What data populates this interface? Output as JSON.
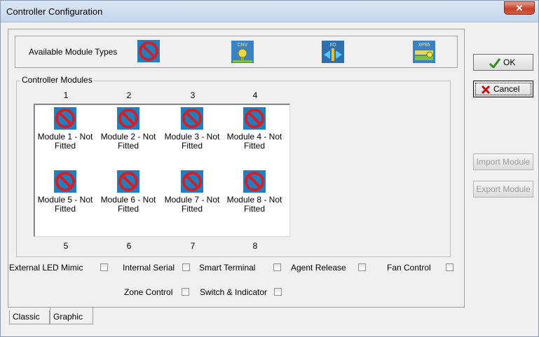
{
  "window": {
    "title": "Controller Configuration",
    "close_glyph": "✕"
  },
  "module_types": {
    "label": "Available Module Types",
    "types": [
      {
        "icon": "not-fitted-icon",
        "caption": ""
      },
      {
        "icon": "cnv-module-icon",
        "caption": "CNV"
      },
      {
        "icon": "io-module-icon",
        "caption": "I/O"
      },
      {
        "icon": "xp95-module-icon",
        "caption": "XP95"
      }
    ]
  },
  "controller_modules": {
    "label": "Controller Modules",
    "top_numbers": [
      "1",
      "2",
      "3",
      "4"
    ],
    "bottom_numbers": [
      "5",
      "6",
      "7",
      "8"
    ],
    "modules": [
      {
        "line1": "Module 1 - Not",
        "line2": "Fitted"
      },
      {
        "line1": "Module 2 - Not",
        "line2": "Fitted"
      },
      {
        "line1": "Module 3 - Not",
        "line2": "Fitted"
      },
      {
        "line1": "Module 4 - Not",
        "line2": "Fitted"
      },
      {
        "line1": "Module 5 - Not",
        "line2": "Fitted"
      },
      {
        "line1": "Module 6 - Not",
        "line2": "Fitted"
      },
      {
        "line1": "Module 7 - Not",
        "line2": "Fitted"
      },
      {
        "line1": "Module 8 - Not",
        "line2": "Fitted"
      }
    ]
  },
  "options": {
    "external_led_mimic": {
      "label": "External LED Mimic",
      "checked": false
    },
    "internal_serial": {
      "label": "Internal Serial",
      "checked": false
    },
    "smart_terminal": {
      "label": "Smart Terminal",
      "checked": false
    },
    "agent_release": {
      "label": "Agent Release",
      "checked": false
    },
    "fan_control": {
      "label": "Fan Control",
      "checked": false
    },
    "zone_control": {
      "label": "Zone Control",
      "checked": false
    },
    "switch_indicator": {
      "label": "Switch & Indicator",
      "checked": false
    }
  },
  "tabs": [
    {
      "label": "Classic",
      "active": false
    },
    {
      "label": "Graphic",
      "active": true
    }
  ],
  "buttons": {
    "ok": "OK",
    "cancel": "Cancel",
    "import": "Import Module",
    "export": "Export Module"
  },
  "colors": {
    "accent": "#1f7fbf",
    "prohibited": "#d0202a",
    "ok_check": "#2e8b1e",
    "cancel_x": "#c01010"
  }
}
